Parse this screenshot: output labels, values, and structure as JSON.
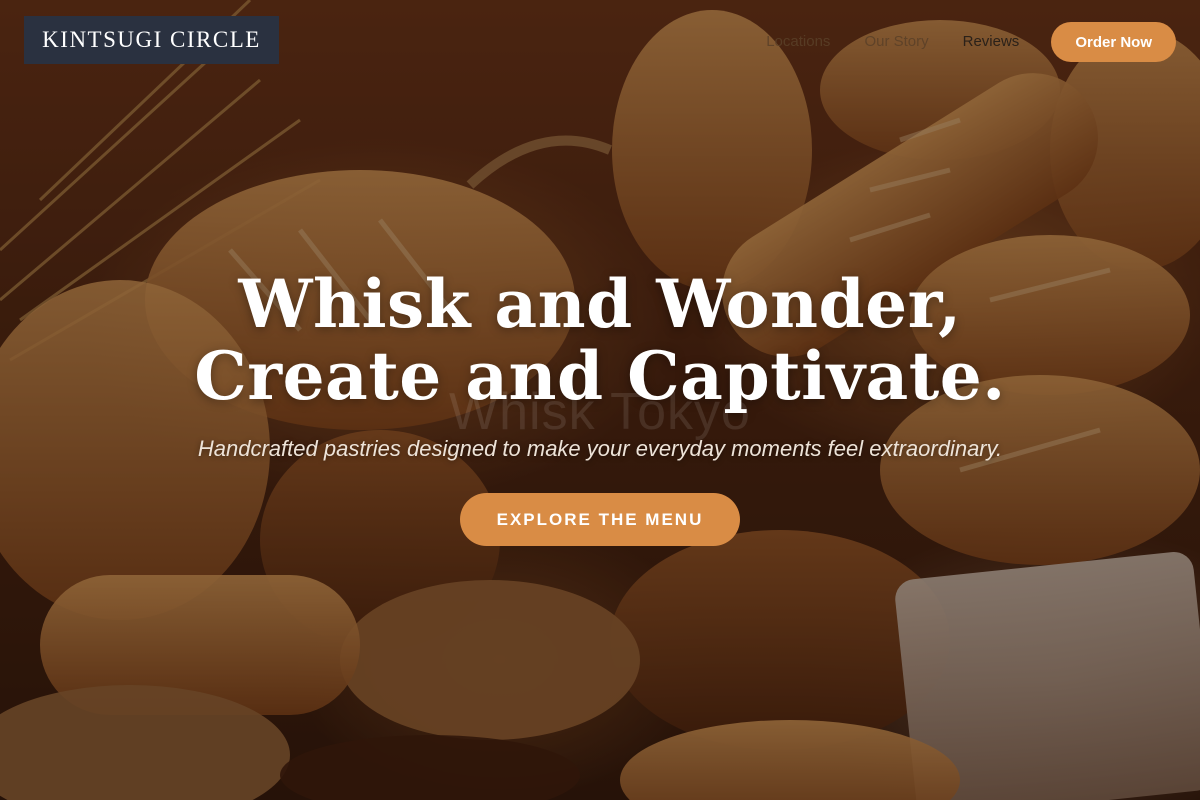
{
  "brand": {
    "logo_text": "KINTSUGI CIRCLE"
  },
  "nav": {
    "items": [
      {
        "label": "Locations"
      },
      {
        "label": "Our Story"
      },
      {
        "label": "Reviews"
      }
    ],
    "order_button": "Order Now"
  },
  "hero": {
    "headline_line1": "Whisk and Wonder,",
    "headline_line2": "Create and Captivate.",
    "ghost_text": "Whisk Tokyo",
    "tagline": "Handcrafted pastries designed to make your everyday moments feel extraordinary.",
    "cta_label": "EXPLORE THE MENU",
    "background_image": "bread-basket-photo"
  },
  "colors": {
    "accent": "#d98c45",
    "logo_bg": "#2a3140",
    "text_light": "#ffffff"
  }
}
